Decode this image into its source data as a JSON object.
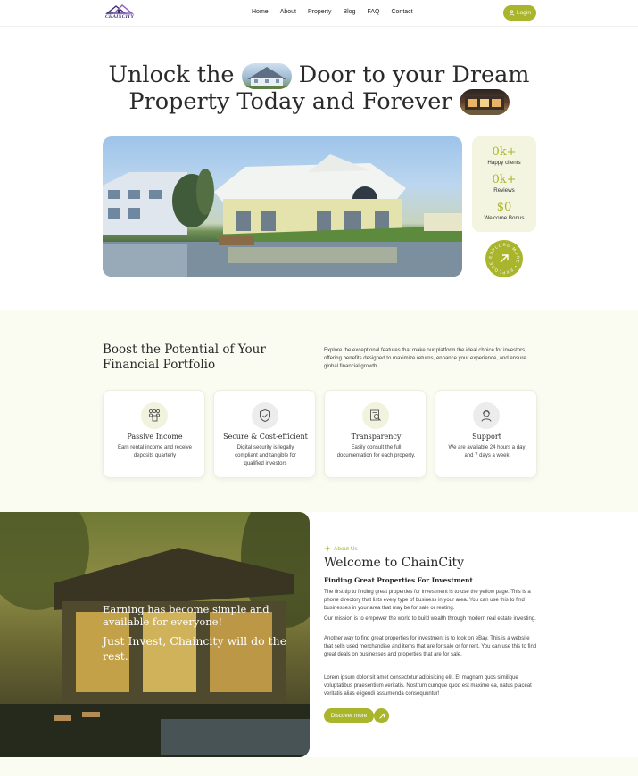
{
  "header": {
    "logo_text": "CHAINCITY",
    "nav": [
      "Home",
      "About",
      "Property",
      "Blog",
      "FAQ",
      "Contact"
    ],
    "login_label": "Login"
  },
  "hero": {
    "title_line1_a": "Unlock the",
    "title_line1_b": "Door to your Dream",
    "title_line2": "Property Today and Forever",
    "stats": [
      {
        "value": "0k+",
        "label": "Happy clients"
      },
      {
        "value": "0k+",
        "label": "Reviews"
      },
      {
        "value": "$0",
        "label": "Welcome Bonus"
      }
    ],
    "explore_text": "EXPLORE MORE • EXPLORE MORE •"
  },
  "features": {
    "title": "Boost the Potential of Your Financial Portfolio",
    "description": "Explore the exceptional features that make our platform the ideal choice for investors, offering benefits designed to maximize returns, enhance your experience, and ensure global financial growth.",
    "cards": [
      {
        "icon": "coins-icon",
        "title": "Passive Income",
        "desc": "Earn rental income and receive deposits quarterly"
      },
      {
        "icon": "shield-check-icon",
        "title": "Secure & Cost-efficient",
        "desc": "Digital security is legally compliant and tangible for qualified investors"
      },
      {
        "icon": "document-search-icon",
        "title": "Transparency",
        "desc": "Easily consult the full documentation for each property."
      },
      {
        "icon": "support-agent-icon",
        "title": "Support",
        "desc": "We are available 24 hours a day and 7 days a week"
      }
    ]
  },
  "about": {
    "overlay_line1": "Earning has become simple and available for everyone!",
    "overlay_line2": "Just Invest, Chaincity will do the rest.",
    "tag": "About Us",
    "title": "Welcome to ChainCity",
    "subtitle": "Finding Great Properties For Investment",
    "paragraphs": [
      "The first tip to finding great properties for investment is to use the yellow page. This is a phone directory that lists every type of business in your area. You can use this to find businesses in your area that may be for sale or renting.",
      "Our mission is to empower the world to build wealth through modern real estate investing.",
      "Another way to find great properties for investment is to look on eBay. This is a website that sells used merchandise and items that are for sale or for rent. You can use this to find great deals on businesses and properties that are for sale.",
      "Lorem ipsum dolor sit amet consectetur adipisicing elit. Et magnam quos similique voluptatibus praesentium veritatis. Nostrum cumque quod est maxime ea, natus placeat veritatis alias eligendi assumenda consequuntur!"
    ],
    "discover_label": "Discover more"
  },
  "colors": {
    "accent": "#a9b52a",
    "soft": "#f4f5e0"
  }
}
